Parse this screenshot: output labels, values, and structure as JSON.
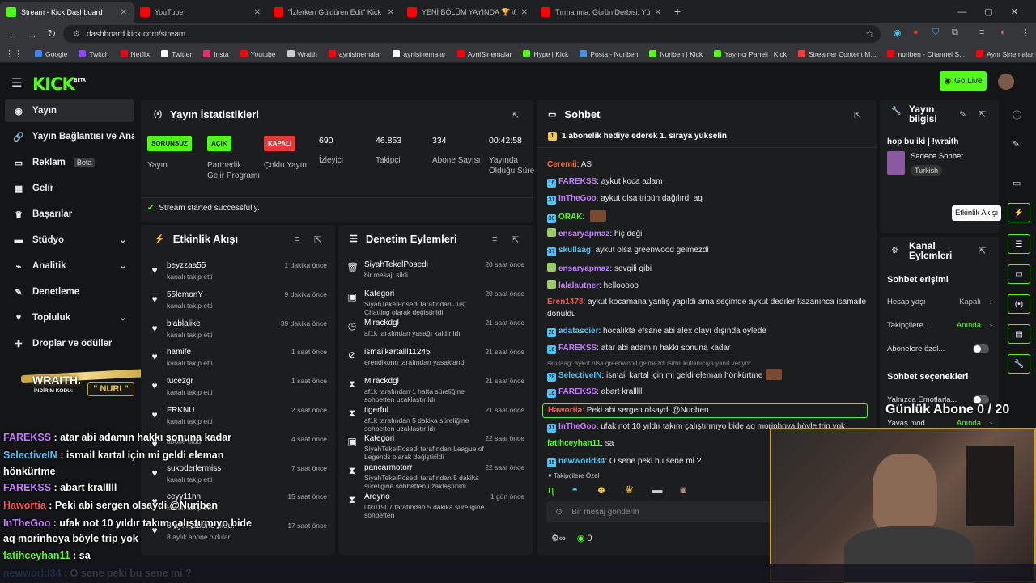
{
  "browser": {
    "tabs": [
      {
        "title": "Stream - Kick Dashboard",
        "color": "#53fc18",
        "active": true
      },
      {
        "title": "YouTube",
        "color": "#ff0000",
        "active": false
      },
      {
        "title": "\"İzlerken Güldüren Edit\" Kick &",
        "color": "#ff0000",
        "active": false
      },
      {
        "title": "YENİ BÖLÜM YAYINDA 🏆 @Ol",
        "color": "#ff0000",
        "active": false
      },
      {
        "title": "Tırmanma, Gürün Derbisi, Yüks",
        "color": "#ff0000",
        "active": false
      }
    ],
    "url": "dashboard.kick.com/stream",
    "bookmarks": [
      {
        "label": "Google",
        "color": "#4285f4"
      },
      {
        "label": "Twitch",
        "color": "#9146ff"
      },
      {
        "label": "Netflix",
        "color": "#e50914"
      },
      {
        "label": "Twitter",
        "color": "#ffffff"
      },
      {
        "label": "Insta",
        "color": "#e1306c"
      },
      {
        "label": "Youtube",
        "color": "#ff0000"
      },
      {
        "label": "Wraith",
        "color": "#cccccc"
      },
      {
        "label": "aynisinemalar",
        "color": "#ff0000"
      },
      {
        "label": "aynisinemalar",
        "color": "#ffffff"
      },
      {
        "label": "AyniSinemalar",
        "color": "#ff0000"
      },
      {
        "label": "Hype | Kick",
        "color": "#53fc18"
      },
      {
        "label": "Posta - Nuriben",
        "color": "#4a90e2"
      },
      {
        "label": "Nuriben | Kick",
        "color": "#53fc18"
      },
      {
        "label": "Yayıncı Paneli | Kick",
        "color": "#53fc18"
      },
      {
        "label": "Streamer Content M...",
        "color": "#ff3b3b"
      },
      {
        "label": "nuriben - Channel S...",
        "color": "#ff0000"
      },
      {
        "label": "Aynı Sinemalar - Ça...",
        "color": "#ff0000"
      }
    ]
  },
  "header": {
    "logo": "KICK",
    "beta": "BETA",
    "go_live": "Go Live"
  },
  "sidebar": [
    {
      "label": "Yayın",
      "icon": "broadcast-icon",
      "glyph": "◉",
      "active": true
    },
    {
      "label": "Yayın Bağlantısı ve Anahtarı",
      "icon": "link-icon",
      "glyph": "🔗"
    },
    {
      "label": "Reklam",
      "icon": "ad-icon",
      "glyph": "▭",
      "badge": "Beta"
    },
    {
      "label": "Gelir",
      "icon": "money-icon",
      "glyph": "▦"
    },
    {
      "label": "Başarılar",
      "icon": "trophy-icon",
      "glyph": "♛"
    },
    {
      "label": "Stüdyo",
      "icon": "studio-icon",
      "glyph": "▬",
      "chevron": true
    },
    {
      "label": "Analitik",
      "icon": "chart-icon",
      "glyph": "⌁",
      "chevron": true
    },
    {
      "label": "Denetleme",
      "icon": "hammer-icon",
      "glyph": "✎"
    },
    {
      "label": "Topluluk",
      "icon": "community-icon",
      "glyph": "♥",
      "chevron": true
    },
    {
      "label": "Droplar ve ödüller",
      "icon": "gift-icon",
      "glyph": "✚"
    }
  ],
  "promo": {
    "brand": "WRAITH.",
    "code_label": "İNDİRİM KODU:",
    "code": "NURI"
  },
  "stats": {
    "title": "Yayın İstatistikleri",
    "items": [
      {
        "value": "SORUNSUZ",
        "label": "Yayın",
        "color": "#53fc18"
      },
      {
        "value": "AÇIK",
        "label": "Partnerlik Gelir Programı",
        "color": "#53fc18"
      },
      {
        "value": "KAPALI",
        "label": "Çoklu Yayın",
        "color": "#e23a3a"
      },
      {
        "value": "690",
        "label": "İzleyici"
      },
      {
        "value": "46.853",
        "label": "Takipçi"
      },
      {
        "value": "334",
        "label": "Abone Sayısı"
      },
      {
        "value": "00:42:58",
        "label": "Yayında Olduğu Süre"
      }
    ],
    "success": "Stream started successfully."
  },
  "activity": {
    "title": "Etkinlik Akışı",
    "rows": [
      {
        "name": "beyzzaa55",
        "sub": "kanalı takip etti",
        "time": "1 dakika önce"
      },
      {
        "name": "55lemonY",
        "sub": "kanalı takip etti",
        "time": "9 dakika önce"
      },
      {
        "name": "blablalike",
        "sub": "kanalı takip etti",
        "time": "39 dakika önce"
      },
      {
        "name": "hamife",
        "sub": "kanalı takip etti",
        "time": "1 saat önce"
      },
      {
        "name": "tucezgr",
        "sub": "kanalı takip etti",
        "time": "1 saat önce"
      },
      {
        "name": "FRKNU",
        "sub": "kanalı takip etti",
        "time": "2 saat önce"
      },
      {
        "name": "",
        "sub": "abone oldu",
        "time": "4 saat önce"
      },
      {
        "name": "sukoderlermiss",
        "sub": "kanalı takip etti",
        "time": "7 saat önce"
      },
      {
        "name": "ceyy11nn",
        "sub": "kanalı takip etti",
        "time": "15 saat önce"
      },
      {
        "name": "8 aylık abone oldu!",
        "sub": "8 aylık abone oldular",
        "time": "17 saat önce"
      }
    ]
  },
  "moderation": {
    "title": "Denetim Eylemleri",
    "rows": [
      {
        "icon": "trash-icon",
        "glyph": "🗑",
        "name": "SiyahTekelPosedi",
        "sub": "bir mesajı sildi",
        "time": "20 saat önce"
      },
      {
        "icon": "category-icon",
        "glyph": "▣",
        "name": "Kategori",
        "sub": "SiyahTekelPosedi tarafından Just Chatting olarak değiştirildi",
        "time": "20 saat önce"
      },
      {
        "icon": "clock-icon",
        "glyph": "◷",
        "name": "Mirackdgl",
        "sub": "af1k tarafından yasağı kaldırıldı",
        "time": "21 saat önce"
      },
      {
        "icon": "ban-icon",
        "glyph": "⊘",
        "name": "ismailkartalll11245",
        "sub": "erendixonn tarafından yasaklandı",
        "time": "21 saat önce"
      },
      {
        "icon": "hourglass-icon",
        "glyph": "⧗",
        "name": "Mirackdgl",
        "sub": "af1k tarafından 1 hafta süreliğine sohbetten uzaklaştırıldı",
        "time": "21 saat önce"
      },
      {
        "icon": "hourglass-icon",
        "glyph": "⧗",
        "name": "tigerful",
        "sub": "af1k tarafından 5 dakika süreliğine sohbetten uzaklaştırıldı",
        "time": "21 saat önce"
      },
      {
        "icon": "category-icon",
        "glyph": "▣",
        "name": "Kategori",
        "sub": "SiyahTekelPosedi tarafından League of Legends olarak değiştirildi",
        "time": "22 saat önce"
      },
      {
        "icon": "hourglass-icon",
        "glyph": "⧗",
        "name": "pancarmotorr",
        "sub": "SiyahTekelPosedi tarafından 5 dakika süreliğine sohbetten uzaklaştırıldı",
        "time": "22 saat önce"
      },
      {
        "icon": "hourglass-icon",
        "glyph": "⧗",
        "name": "Ardyno",
        "sub": "utku1907 tarafından 5 dakika süreliğine sohbetten",
        "time": "1 gün önce"
      }
    ]
  },
  "chat": {
    "title": "Sohbet",
    "pinned": "1 abonelik hediye ederek 1. sıraya yükselin",
    "messages": [
      {
        "user": "Ceremii",
        "color": "#ff7043",
        "text": "AS"
      },
      {
        "user": "FAREKSS",
        "color": "#c77dff",
        "text": "aykut koca adam",
        "badge": "16"
      },
      {
        "user": "InTheGoo",
        "color": "#c77dff",
        "text": "aykut olsa tribün dağılırdı aq",
        "badge": "31"
      },
      {
        "user": "ORAK",
        "color": "#53fc18",
        "text": "",
        "badge": "30",
        "emote": true
      },
      {
        "user": "ensaryapmaz",
        "color": "#c77dff",
        "text": "hiç değil",
        "badge": "●"
      },
      {
        "user": "skullaag",
        "color": "#4fc3f7",
        "text": "aykut olsa greenwood gelmezdi",
        "badge": "37"
      },
      {
        "user": "ensaryapmaz",
        "color": "#c77dff",
        "text": "sevgili gibi",
        "badge": "●"
      },
      {
        "user": "lalalautner",
        "color": "#c77dff",
        "text": "hellooooo",
        "badge": "●"
      },
      {
        "user": "Eren1478",
        "color": "#ff5252",
        "text": "aykut kocamana yanlış yapıldı ama seçimde aykut dedıler kazanınca isamaile"
      },
      {
        "user": "",
        "color": "#e6e6e6",
        "text": "dönüldü"
      },
      {
        "user": "adatascier",
        "color": "#4fc3f7",
        "text": "hocalıkta efsane abi alex olayı dışında oylede",
        "badge": "28"
      },
      {
        "user": "FAREKSS",
        "color": "#c77dff",
        "text": "atar abi adamın hakkı sonuna kadar",
        "badge": "16"
      },
      {
        "user": "",
        "color": "#999",
        "text": "skullaag: aykut olsa greenwood gelmezdi isimli kullanıcıya yanıt veriyor",
        "reply": true
      },
      {
        "user": "SelectiveIN",
        "color": "#4fc3f7",
        "text": "ismail kartal için mi geldi eleman hönkürtme",
        "badge": "28",
        "emote": true
      },
      {
        "user": "FAREKSS",
        "color": "#c77dff",
        "text": "abart kralllll",
        "badge": "16"
      },
      {
        "user": "Hawortia",
        "color": "#ff5252",
        "text": "Peki abi sergen olsaydi @Nuriben",
        "highlight": true
      },
      {
        "user": "InTheGoo",
        "color": "#c77dff",
        "text": "ufak not 10 yıldır takım çalıştırmıyo bide aq morinhoya böyle trip yok",
        "badge": "31"
      },
      {
        "user": "fatihceyhan11",
        "color": "#53fc18",
        "text": "sa"
      },
      {
        "user": "newworld34",
        "color": "#4fc3f7",
        "text": "O sene peki bu sene mi ?",
        "badge": "35"
      }
    ],
    "emotes_label": "Takipçilere Özel",
    "input_placeholder": "Bir mesaj gönderin",
    "count": "0"
  },
  "streaminfo": {
    "title": "Yayın bilgisi",
    "stream_title": "hop bu iki | !wraith",
    "category": "Sadece Sohbet",
    "tag": "Turkish"
  },
  "channel": {
    "title": "Kanal Eylemleri",
    "chat_access": "Sohbet erişimi",
    "rows": [
      {
        "label": "Hesap yaşı",
        "value": "Kapalı",
        "value_color": "#bbbbbb"
      },
      {
        "label": "Takipçilere...",
        "value": "Anında",
        "value_color": "#53fc18"
      },
      {
        "label": "Abonelere özel...",
        "toggle": true
      }
    ],
    "chat_options": "Sohbet seçenekleri",
    "rows2": [
      {
        "label": "Yalnızca Emotlarla...",
        "toggle": true
      },
      {
        "label": "Yavaş mod",
        "value": "Anında",
        "value_color": "#53fc18"
      }
    ]
  },
  "rail": {
    "tooltip": "Etkinlik Akışı"
  },
  "overlay": {
    "sub_goal": "Günlük Abone 0 / 20",
    "lines": [
      {
        "user": "FAREKSS",
        "color": "#c77dff",
        "text": " : atar abi adamın hakkı sonuna kadar"
      },
      {
        "user": "SelectiveIN",
        "color": "#4fc3f7",
        "text": " : ismail kartal için mi geldi eleman"
      },
      {
        "user": "",
        "color": "#fff",
        "text": "hönkürtme"
      },
      {
        "user": "FAREKSS",
        "color": "#c77dff",
        "text": " : abart kralllll"
      },
      {
        "user": "Hawortia",
        "color": "#ff5252",
        "text": " : Peki abi sergen olsaydi @Nuriben"
      },
      {
        "user": "InTheGoo",
        "color": "#c77dff",
        "text": " : ufak not 10 yıldır takım çalıştırmıyo bide"
      },
      {
        "user": "",
        "color": "#fff",
        "text": "aq morinhoya böyle trip yok"
      },
      {
        "user": "fatihceyhan11",
        "color": "#53fc18",
        "text": " : sa"
      },
      {
        "user": "newworld34",
        "color": "#4fc3f7",
        "text": " : O sene peki bu sene mi ?"
      }
    ]
  }
}
